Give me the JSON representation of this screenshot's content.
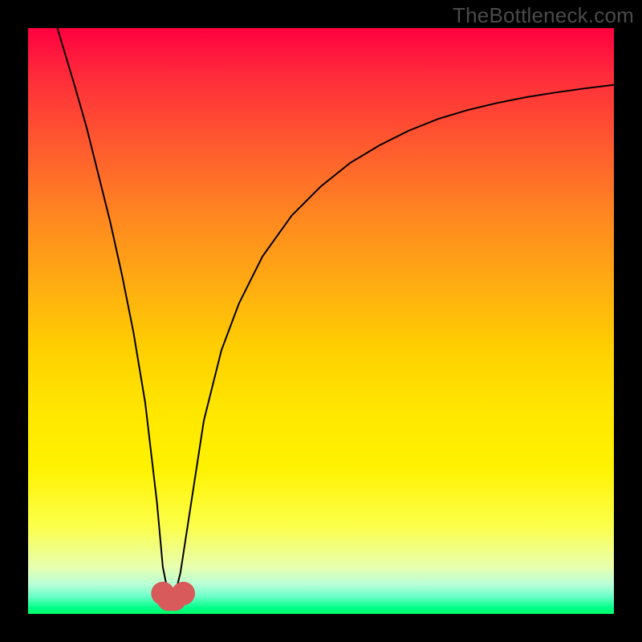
{
  "watermark": {
    "text": "TheBottleneck.com"
  },
  "chart_data": {
    "type": "line",
    "title": "",
    "xlabel": "",
    "ylabel": "",
    "xlim": [
      0,
      100
    ],
    "ylim": [
      0,
      100
    ],
    "grid": false,
    "legend": false,
    "series": [
      {
        "name": "bottleneck-curve",
        "x": [
          5,
          8,
          10,
          12,
          14,
          16,
          18,
          20,
          22,
          23,
          24,
          25,
          26,
          28,
          30,
          33,
          36,
          40,
          45,
          50,
          55,
          60,
          65,
          70,
          75,
          80,
          85,
          90,
          95,
          100
        ],
        "values": [
          100,
          90,
          83,
          75,
          67,
          58,
          48,
          36,
          19,
          8,
          3,
          3,
          7,
          20,
          33,
          45,
          53,
          61,
          68,
          73,
          77,
          80,
          82.5,
          84.5,
          86,
          87.2,
          88.2,
          89,
          89.7,
          90.3
        ]
      }
    ],
    "markers": [
      {
        "name": "min-marker-a",
        "x": 23,
        "y": 3.5,
        "r": 2.0,
        "color": "#d85a5a"
      },
      {
        "name": "min-marker-b",
        "x": 24,
        "y": 2.5,
        "r": 2.0,
        "color": "#d85a5a"
      },
      {
        "name": "min-marker-c",
        "x": 25,
        "y": 2.5,
        "r": 2.0,
        "color": "#d85a5a"
      },
      {
        "name": "min-marker-d",
        "x": 26.5,
        "y": 3.5,
        "r": 2.0,
        "color": "#d85a5a"
      }
    ],
    "background_gradient": [
      {
        "pos": 0,
        "color": "#ff0040"
      },
      {
        "pos": 55,
        "color": "#ffd000"
      },
      {
        "pos": 85,
        "color": "#fcff4a"
      },
      {
        "pos": 100,
        "color": "#00ff66"
      }
    ]
  }
}
